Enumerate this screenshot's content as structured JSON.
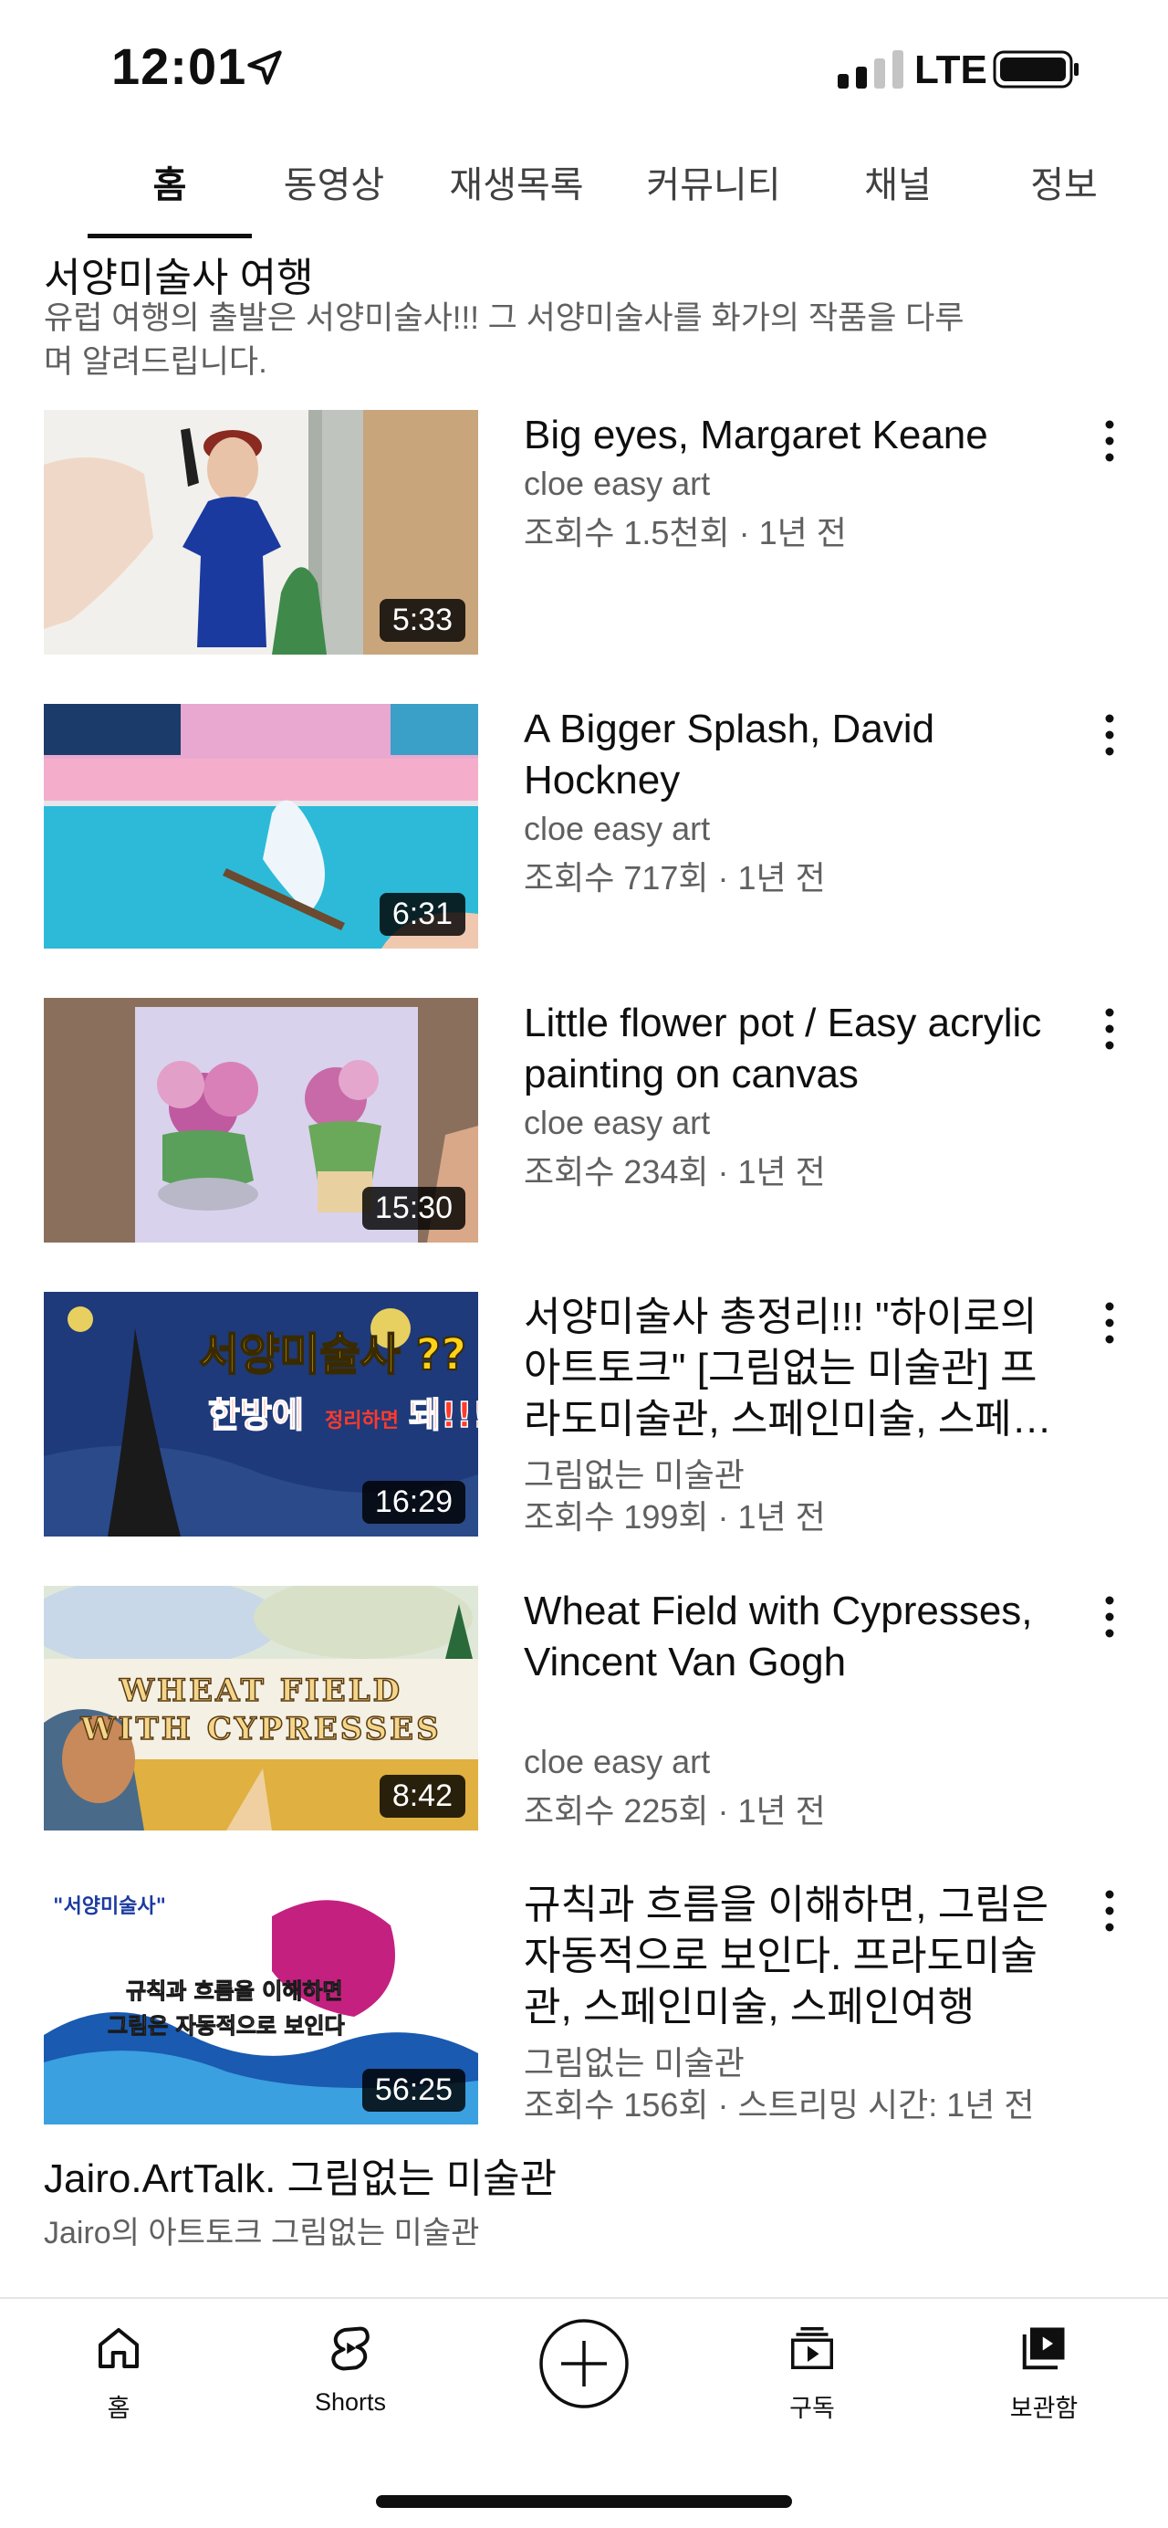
{
  "status_bar": {
    "time": "12:01",
    "network": "LTE"
  },
  "tabs": [
    {
      "label": "홈",
      "active": true
    },
    {
      "label": "동영상",
      "active": false
    },
    {
      "label": "재생목록",
      "active": false
    },
    {
      "label": "커뮤니티",
      "active": false
    },
    {
      "label": "채널",
      "active": false
    },
    {
      "label": "정보",
      "active": false
    }
  ],
  "section": {
    "title": "서양미술사 여행",
    "description": "유럽 여행의 출발은 서양미술사!!! 그 서양미술사를 화가의 작품을 다루며 알려드립니다."
  },
  "videos": [
    {
      "title": "Big eyes, Margaret Keane",
      "channel": "cloe easy art",
      "meta": "조회수 1.5천회 · 1년 전",
      "duration": "5:33"
    },
    {
      "title": "A Bigger Splash, David Hockney",
      "channel": "cloe easy art",
      "meta": "조회수 717회 · 1년 전",
      "duration": "6:31"
    },
    {
      "title": "Little flower pot / Easy acrylic painting on canvas",
      "channel": "cloe easy art",
      "meta": "조회수 234회 · 1년 전",
      "duration": "15:30"
    },
    {
      "title": "서양미술사 총정리!!! \"하이로의 아트토크\" [그림없는 미술관] 프라도미술관, 스페인미술, 스페인여행",
      "channel": "그림없는 미술관",
      "meta": "조회수 199회 · 1년 전",
      "duration": "16:29",
      "thumb_text_1": "서양미술사 ??",
      "thumb_text_2": "한방에",
      "thumb_text_3": "정리하면",
      "thumb_text_4": "돼!!!"
    },
    {
      "title": "Wheat Field with Cypresses, Vincent Van Gogh",
      "channel": "cloe easy art",
      "meta": "조회수 225회 · 1년 전",
      "duration": "8:42",
      "thumb_text_1": "WHEAT FIELD",
      "thumb_text_2": "WITH CYPRESSES"
    },
    {
      "title": "규칙과 흐름을 이해하면, 그림은 자동적으로 보인다. 프라도미술관, 스페인미술, 스페인여행",
      "channel": "그림없는 미술관",
      "meta": "조회수 156회 · 스트리밍 시간: 1년 전",
      "duration": "56:25",
      "thumb_text_1": "\"서양미술사\"",
      "thumb_text_2": "규칙과 흐름을 이해하면",
      "thumb_text_3": "그림은 자동적으로 보인다"
    }
  ],
  "next_section": {
    "title": "Jairo.ArtTalk. 그림없는 미술관",
    "description": "Jairo의 아트토크 그림없는 미술관"
  },
  "bottom_nav": [
    {
      "label": "홈",
      "icon": "home-icon"
    },
    {
      "label": "Shorts",
      "icon": "shorts-icon"
    },
    {
      "label": "",
      "icon": "create-icon"
    },
    {
      "label": "구독",
      "icon": "subscriptions-icon"
    },
    {
      "label": "보관함",
      "icon": "library-icon"
    }
  ]
}
